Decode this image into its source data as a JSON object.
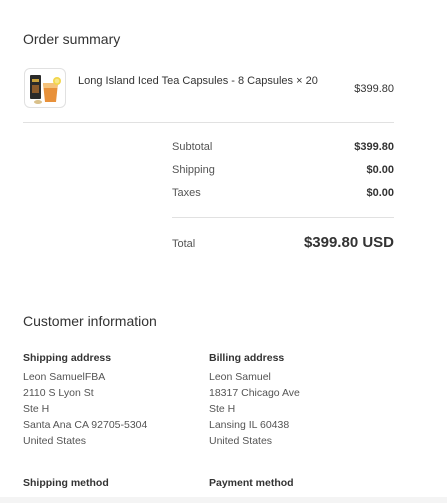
{
  "order_summary": {
    "title": "Order summary",
    "item": {
      "name": "Long Island Iced Tea Capsules - 8 Capsules × 20",
      "price": "$399.80",
      "thumbnail_icon": "capsule-box-and-drink-image"
    },
    "subtotal_label": "Subtotal",
    "subtotal_value": "$399.80",
    "shipping_label": "Shipping",
    "shipping_value": "$0.00",
    "taxes_label": "Taxes",
    "taxes_value": "$0.00",
    "total_label": "Total",
    "total_value": "$399.80 USD"
  },
  "customer_info": {
    "title": "Customer information",
    "shipping_address": {
      "heading": "Shipping address",
      "lines": [
        "Leon SamuelFBA",
        "2110 S Lyon St",
        "Ste H",
        "Santa Ana CA 92705-5304",
        "United States"
      ]
    },
    "billing_address": {
      "heading": "Billing address",
      "lines": [
        "Leon Samuel",
        "18317 Chicago Ave",
        "Ste H",
        "Lansing IL 60438",
        "United States"
      ]
    },
    "shipping_method_label": "Shipping method",
    "payment_method_label": "Payment method"
  }
}
